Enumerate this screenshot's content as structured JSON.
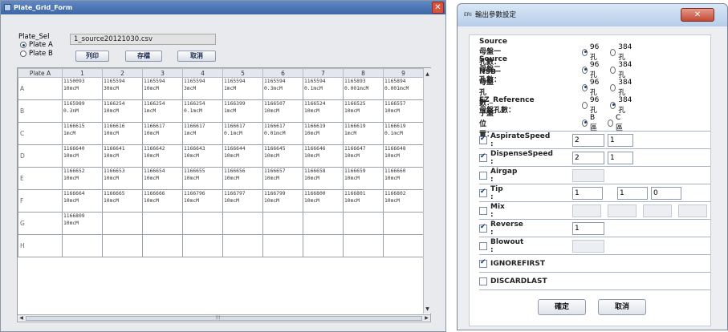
{
  "left_window": {
    "title": "Plate_Grid_Form",
    "plate_sel_label": "Plate_Sel",
    "plate_options": [
      {
        "label": "Plate A",
        "selected": true
      },
      {
        "label": "Plate B",
        "selected": false
      }
    ],
    "file_name": "1_source20121030.csv",
    "buttons": {
      "print": "列印",
      "save": "存檔",
      "cancel": "取消"
    },
    "grid": {
      "corner_header": "Plate A",
      "columns": [
        "1",
        "2",
        "3",
        "4",
        "5",
        "6",
        "7",
        "8",
        "9"
      ],
      "rows": [
        {
          "label": "A",
          "cells": [
            "1150093\n10mcM",
            "1165594\n30mcM",
            "1165594\n10mcM",
            "1165594\n3mcM",
            "1165594\n1mcM",
            "1165594\n0.3mcM",
            "1165594\n0.1mcM",
            "1165893\n0.001mcM",
            "1165894\n0.001mcM"
          ]
        },
        {
          "label": "B",
          "cells": [
            "1165989\n0.3nM",
            "1166254\n10mcM",
            "1166254\n1mcM",
            "1166254\n0.1mcM",
            "1166399\n1mcM",
            "1166507\n10mcM",
            "1166524\n10mcM",
            "1166525\n10mcM",
            "1166557\n10mcM"
          ]
        },
        {
          "label": "C",
          "cells": [
            "1166615\n1mcM",
            "1166616\n10mcM",
            "1166617\n10mcM",
            "1166617\n1mcM",
            "1166617\n0.1mcM",
            "1166617\n0.01mcM",
            "1166619\n10mcM",
            "1166619\n1mcM",
            "1166619\n0.1mcM"
          ]
        },
        {
          "label": "D",
          "cells": [
            "1166640\n10mcM",
            "1166641\n10mcM",
            "1166642\n10mcM",
            "1166643\n10mcM",
            "1166644\n10mcM",
            "1166645\n10mcM",
            "1166646\n10mcM",
            "1166647\n10mcM",
            "1166648\n10mcM"
          ]
        },
        {
          "label": "E",
          "cells": [
            "1166652\n10mcM",
            "1166653\n10mcM",
            "1166654\n10mcM",
            "1166655\n10mcM",
            "1166656\n10mcM",
            "1166657\n10mcM",
            "1166658\n10mcM",
            "1166659\n10mcM",
            "1166660\n10mcM"
          ]
        },
        {
          "label": "F",
          "cells": [
            "1166664\n10mcM",
            "1166665\n10mcM",
            "1166666\n10mcM",
            "1166796\n10mcM",
            "1166797\n10mcM",
            "1166799\n10mcM",
            "1166800\n10mcM",
            "1166801\n10mcM",
            "1166802\n10mcM"
          ]
        },
        {
          "label": "G",
          "cells": [
            "1166809\n10mcM",
            "",
            "",
            "",
            "",
            "",
            "",
            "",
            ""
          ]
        },
        {
          "label": "H",
          "cells": [
            "",
            "",
            "",
            "",
            "",
            "",
            "",
            "",
            ""
          ]
        }
      ]
    },
    "scrollbar_grip": "|||"
  },
  "right_window": {
    "title": "輸出參數設定",
    "title_icon": "ERI",
    "radio_rows": [
      {
        "label": "Source母盤一孔數：",
        "options": [
          {
            "label": "96孔",
            "selected": true
          },
          {
            "label": "384孔",
            "selected": false
          }
        ]
      },
      {
        "label": "Source母盤二孔數：",
        "options": [
          {
            "label": "96孔",
            "selected": true
          },
          {
            "label": "384孔",
            "selected": false
          }
        ]
      },
      {
        "label": "NSB母盤孔數：",
        "options": [
          {
            "label": "96孔",
            "selected": true
          },
          {
            "label": "384孔",
            "selected": false
          }
        ]
      },
      {
        "label": "EZ_Reference母盤孔數：",
        "options": [
          {
            "label": "96孔",
            "selected": false
          },
          {
            "label": "384孔",
            "selected": true
          }
        ]
      },
      {
        "label": "子盤位置：",
        "options": [
          {
            "label": "B區",
            "selected": true
          },
          {
            "label": "C區",
            "selected": false
          }
        ]
      }
    ],
    "check_rows": [
      {
        "label": "AspirateSpeed :",
        "checked": true,
        "fields": [
          "2",
          "1"
        ]
      },
      {
        "label": "DispenseSpeed :",
        "checked": true,
        "fields": [
          "2",
          "1"
        ]
      },
      {
        "label": "Airgap :",
        "checked": false,
        "fields": [
          ""
        ]
      },
      {
        "label": "Tip :",
        "checked": true,
        "fields": [
          "1",
          "1",
          "0"
        ]
      },
      {
        "label": "Mix :",
        "checked": false,
        "fields": [
          "",
          "",
          "",
          ""
        ]
      },
      {
        "label": "Reverse :",
        "checked": true,
        "fields": [
          "1"
        ]
      },
      {
        "label": "Blowout :",
        "checked": false,
        "fields": [
          ""
        ]
      },
      {
        "label": "IGNOREFIRST",
        "checked": true,
        "fields": []
      },
      {
        "label": "DISCARDLAST",
        "checked": false,
        "fields": []
      }
    ],
    "buttons": {
      "ok": "確定",
      "cancel": "取消"
    }
  }
}
